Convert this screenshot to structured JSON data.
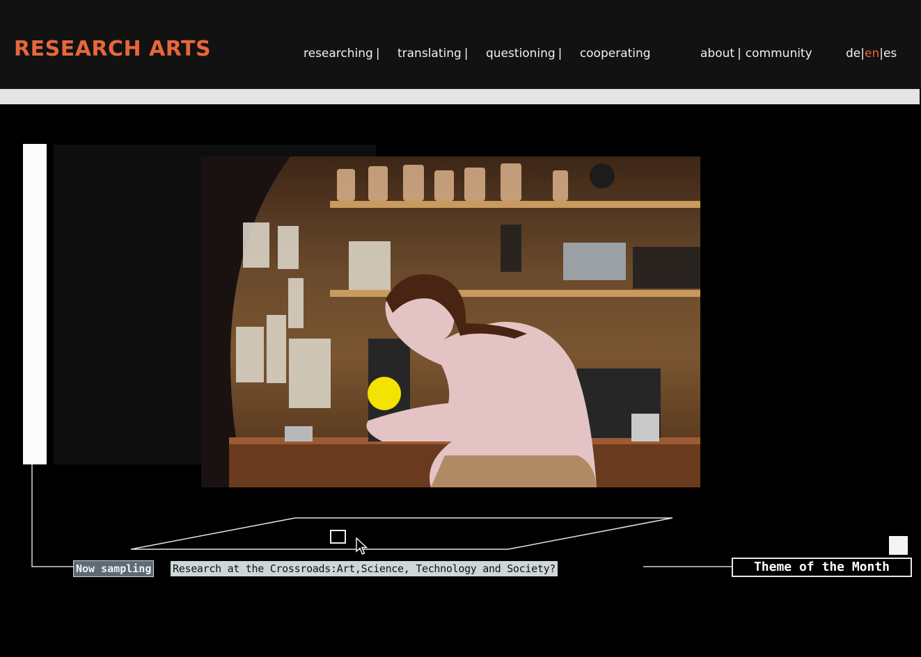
{
  "header": {
    "logo": "RESEARCH ARTS",
    "nav_main": [
      {
        "label": "researching",
        "sep": "|"
      },
      {
        "label": "translating",
        "sep": "|"
      },
      {
        "label": "questioning",
        "sep": "|"
      },
      {
        "label": "cooperating",
        "sep": ""
      }
    ],
    "nav_secondary": {
      "about": "about",
      "sep": "|",
      "community": "community"
    },
    "languages": {
      "de": "de",
      "en": "en",
      "es": "es",
      "sep": "|"
    }
  },
  "captions": {
    "now_sampling": "Now sampling",
    "title": "Research at the Crossroads:Art,Science, Technology and Society?",
    "theme": "Theme of the Month"
  },
  "colors": {
    "accent": "#e8663a",
    "highlight": "#f4e300",
    "background": "#000000"
  },
  "icons": [
    "cursor-arrow-icon"
  ]
}
